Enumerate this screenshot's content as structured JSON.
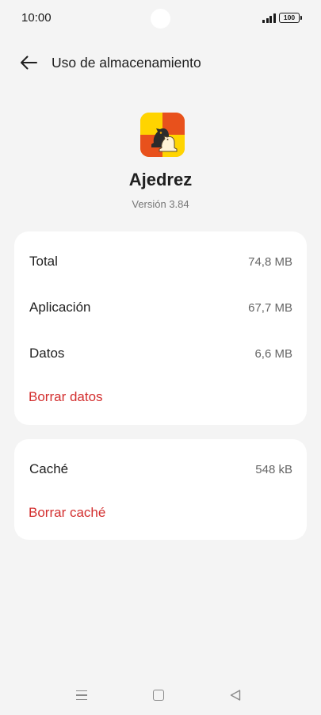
{
  "status_bar": {
    "time": "10:00",
    "battery": "100"
  },
  "header": {
    "title": "Uso de almacenamiento"
  },
  "app": {
    "name": "Ajedrez",
    "version": "Versión 3.84"
  },
  "storage": {
    "rows": [
      {
        "label": "Total",
        "value": "74,8 MB"
      },
      {
        "label": "Aplicación",
        "value": "67,7 MB"
      },
      {
        "label": "Datos",
        "value": "6,6 MB"
      }
    ],
    "clear_data_label": "Borrar datos"
  },
  "cache": {
    "label": "Caché",
    "value": "548 kB",
    "clear_cache_label": "Borrar caché"
  },
  "colors": {
    "accent": "#d32f2f",
    "background": "#f4f4f4",
    "card": "#ffffff"
  },
  "icons": {
    "back": "arrow-left-icon",
    "app": "chess-knight-icon",
    "signal": "signal-icon",
    "battery": "battery-icon",
    "nav_menu": "menu-icon",
    "nav_home": "home-square-icon",
    "nav_back": "triangle-back-icon"
  }
}
